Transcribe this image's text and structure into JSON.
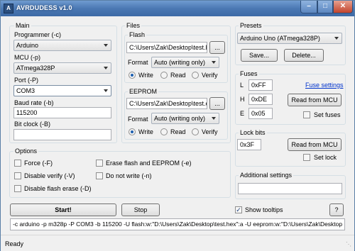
{
  "window": {
    "title": "AVRDUDESS v1.0",
    "icon_letter": "A"
  },
  "main": {
    "title": "Main",
    "programmer_label": "Programmer (-c)",
    "programmer_value": "Arduino",
    "mcu_label": "MCU (-p)",
    "mcu_value": "ATmega328P",
    "port_label": "Port (-P)",
    "port_value": "COM3",
    "baud_label": "Baud rate (-b)",
    "baud_value": "115200",
    "bitclock_label": "Bit clock (-B)",
    "bitclock_value": ""
  },
  "files": {
    "title": "Files",
    "flash": {
      "title": "Flash",
      "path": "C:\\Users\\Zak\\Desktop\\test.h",
      "browse": "...",
      "format_label": "Format",
      "format_value": "Auto (writing only)",
      "write": "Write",
      "read": "Read",
      "verify": "Verify"
    },
    "eeprom": {
      "title": "EEPROM",
      "path": "C:\\Users\\Zak\\Desktop\\test.e",
      "browse": "...",
      "format_label": "Format",
      "format_value": "Auto (writing only)",
      "write": "Write",
      "read": "Read",
      "verify": "Verify"
    }
  },
  "presets": {
    "title": "Presets",
    "value": "Arduino Uno (ATmega328P)",
    "save": "Save...",
    "delete": "Delete..."
  },
  "fuses": {
    "title": "Fuses",
    "l_label": "L",
    "l_value": "0xFF",
    "h_label": "H",
    "h_value": "0xDE",
    "e_label": "E",
    "e_value": "0x05",
    "settings_link": "Fuse settings",
    "read_button": "Read from MCU",
    "set_label": "Set fuses"
  },
  "lockbits": {
    "title": "Lock bits",
    "value": "0x3F",
    "read_button": "Read from MCU",
    "set_label": "Set lock"
  },
  "options": {
    "title": "Options",
    "force": "Force (-F)",
    "disable_verify": "Disable verify (-V)",
    "disable_flash_erase": "Disable flash erase (-D)",
    "erase_flash": "Erase flash and EEPROM (-e)",
    "do_not_write": "Do not write (-n)"
  },
  "additional": {
    "title": "Additional settings",
    "value": ""
  },
  "actions": {
    "start": "Start!",
    "stop": "Stop",
    "show_tooltips": "Show tooltips",
    "help": "?"
  },
  "command": "-c arduino -p m328p -P COM3 -b 115200 -U flash:w:\"D:\\Users\\Zak\\Desktop\\test.hex\":a -U eeprom:w:\"D:\\Users\\Zak\\Desktop",
  "status": "Ready"
}
